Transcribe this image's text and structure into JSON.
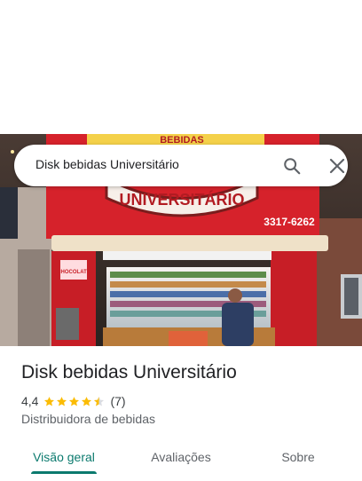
{
  "search": {
    "query": "Disk bebidas Universitário",
    "search_icon": "search-icon",
    "close_icon": "close-icon"
  },
  "hero_photo": {
    "sign_main": "UNIVERSITÁRIO",
    "sign_top": "BEBIDAS",
    "sign_phone": "3317-6262",
    "sign_side": "CHOCOLATE"
  },
  "place": {
    "name": "Disk bebidas Universitário",
    "rating": "4,4",
    "rating_numeric": 4.4,
    "review_count": "(7)",
    "category": "Distribuidora de bebidas"
  },
  "tabs": [
    {
      "label": "Visão geral",
      "active": true
    },
    {
      "label": "Avaliações",
      "active": false
    },
    {
      "label": "Sobre",
      "active": false
    }
  ],
  "colors": {
    "accent": "#0b7a6e",
    "star": "#fbbc04",
    "sign_red": "#d6222b"
  }
}
